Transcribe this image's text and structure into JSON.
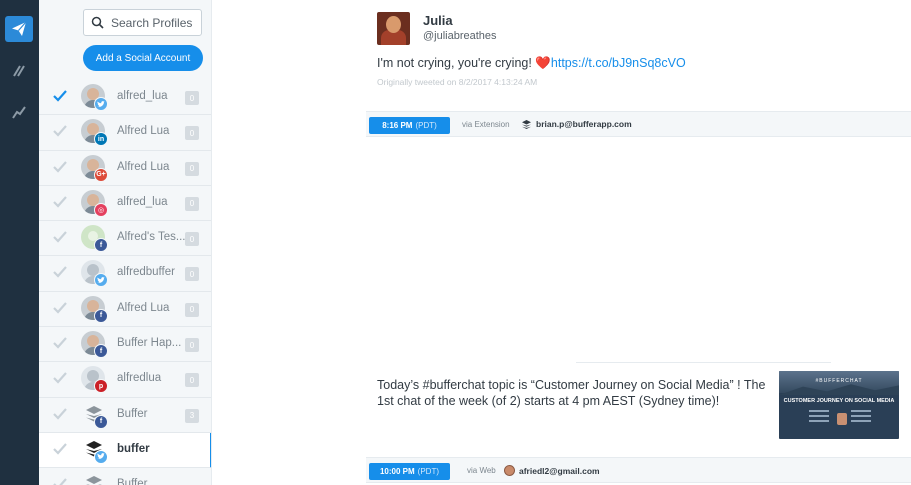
{
  "search": {
    "placeholder": "Search Profiles"
  },
  "sidebar": {
    "add_button": "Add a Social Account",
    "profiles": [
      {
        "name": "alfred_lua",
        "network": "twitter",
        "count": "0",
        "checked": true
      },
      {
        "name": "Alfred Lua",
        "network": "linkedin",
        "count": "0",
        "checked": false
      },
      {
        "name": "Alfred Lua",
        "network": "google",
        "count": "0",
        "checked": false
      },
      {
        "name": "alfred_lua",
        "network": "instagram",
        "count": "0",
        "checked": false
      },
      {
        "name": "Alfred's Tes...",
        "network": "facebook",
        "count": "0",
        "checked": false
      },
      {
        "name": "alfredbuffer",
        "network": "twitter",
        "count": "0",
        "checked": false
      },
      {
        "name": "Alfred Lua",
        "network": "facebook",
        "count": "0",
        "checked": false
      },
      {
        "name": "Buffer Hap...",
        "network": "facebook",
        "count": "0",
        "checked": false
      },
      {
        "name": "alfredlua",
        "network": "pinterest",
        "count": "0",
        "checked": false
      },
      {
        "name": "Buffer",
        "network": "facebook",
        "count": "3",
        "checked": false
      },
      {
        "name": "buffer",
        "network": "twitter",
        "count": "",
        "checked": false,
        "selected": true
      },
      {
        "name": "Buffer",
        "network": "facebook",
        "count": "",
        "checked": false
      }
    ]
  },
  "post1": {
    "user_name": "Julia",
    "user_handle": "@juliabreathes",
    "text_before": "I'm not crying, you're crying! ",
    "heart": "❤️",
    "link": "https://t.co/bJ9nSq8cVO",
    "originally": "Originally tweeted on 8/2/2017 4:13:24 AM",
    "time": "8:16 PM",
    "tz": "(PDT)",
    "via": "via Extension",
    "author": "brian.p@bufferapp.com"
  },
  "post2": {
    "text": "Today’s #bufferchat topic is “Customer Journey on Social Media” ! The 1st chat of the week (of 2) starts at 4 pm AEST (Sydney time)!",
    "thumb_title": "#BUFFERCHAT",
    "thumb_headline": "CUSTOMER JOURNEY ON SOCIAL MEDIA",
    "time": "10:00 PM",
    "tz": "(PDT)",
    "via": "via Web",
    "author": "afriedl2@gmail.com"
  },
  "colors": {
    "accent": "#168eea",
    "nav_bg": "#1f3040",
    "sidebar_bg": "#f4f7f9"
  }
}
